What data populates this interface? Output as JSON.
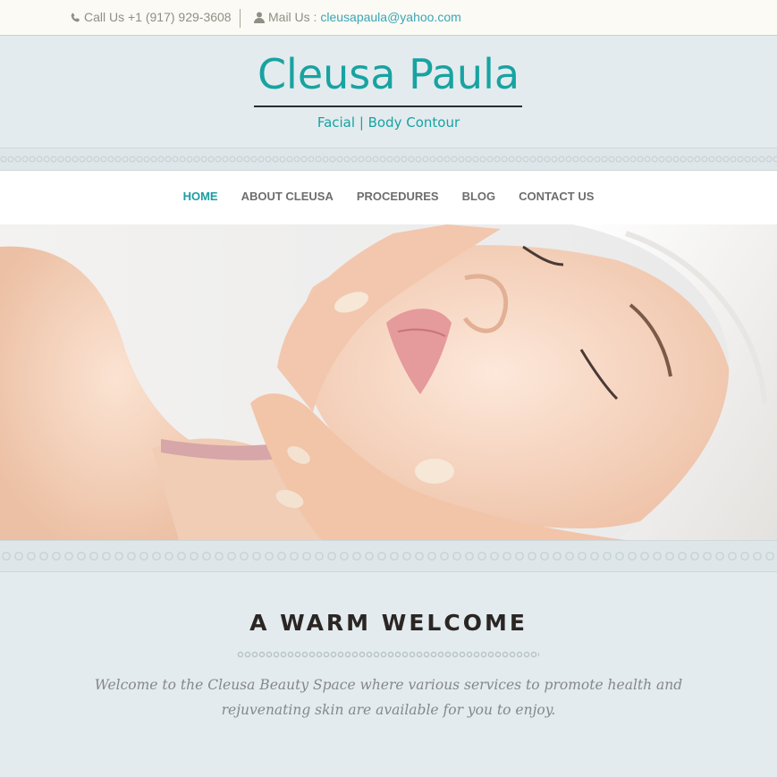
{
  "topbar": {
    "phone_label": "Call Us +1 (917) 929-3608",
    "mail_prefix": "Mail Us : ",
    "mail_address": "cleusapaula@yahoo.com",
    "phone_icon": "phone-icon",
    "mail_icon": "user-icon"
  },
  "header": {
    "title": "Cleusa Paula",
    "subtitle": "Facial | Body Contour"
  },
  "nav": {
    "items": [
      {
        "label": "HOME",
        "active": true
      },
      {
        "label": "ABOUT CLEUSA",
        "active": false
      },
      {
        "label": "PROCEDURES",
        "active": false
      },
      {
        "label": "BLOG",
        "active": false
      },
      {
        "label": "CONTACT US",
        "active": false
      }
    ]
  },
  "welcome": {
    "title": "A WARM WELCOME",
    "text": "Welcome to the Cleusa Beauty Space where various services to promote health and rejuvenating skin are available for you to enjoy."
  },
  "colors": {
    "accent": "#17a3a1",
    "link": "#39a6b6",
    "background": "#e3ebee",
    "nav_text": "#6d6d6d"
  }
}
